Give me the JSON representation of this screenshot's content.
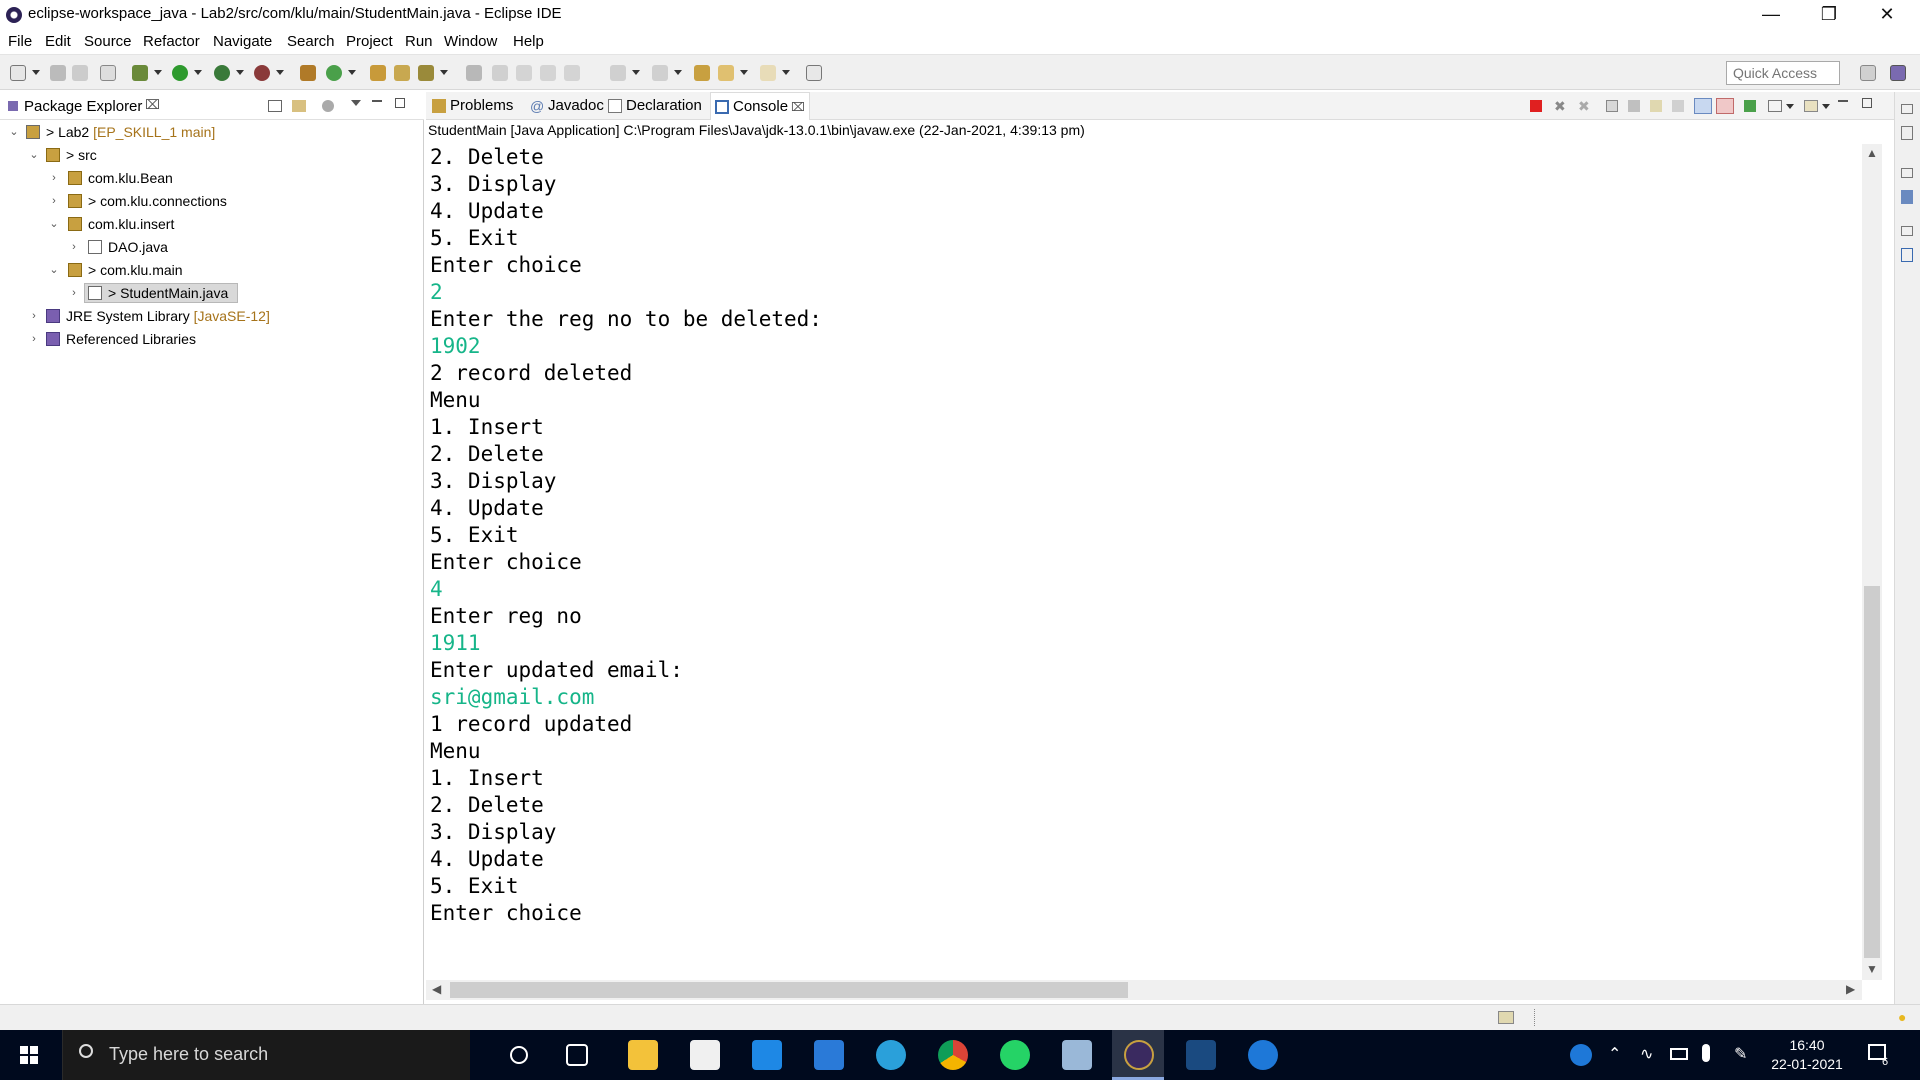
{
  "window": {
    "title": "eclipse-workspace_java - Lab2/src/com/klu/main/StudentMain.java - Eclipse IDE",
    "minimize_icon": "minimize-icon",
    "maximize_icon": "restore-icon",
    "close_icon": "close-icon"
  },
  "menu": [
    "File",
    "Edit",
    "Source",
    "Refactor",
    "Navigate",
    "Search",
    "Project",
    "Run",
    "Window",
    "Help"
  ],
  "toolbar": {
    "quick_access_placeholder": "Quick Access"
  },
  "package_explorer": {
    "title": "Package Explorer",
    "tree": [
      {
        "label": "> Lab2",
        "decoration": " [EP_SKILL_1 main]",
        "icon": "project-icon",
        "expanded": true
      },
      {
        "label": "> src",
        "decoration": "",
        "icon": "source-folder-icon",
        "expanded": true
      },
      {
        "label": "com.klu.Bean",
        "decoration": "",
        "icon": "package-icon",
        "expanded": false
      },
      {
        "label": "> com.klu.connections",
        "decoration": "",
        "icon": "package-icon",
        "expanded": false
      },
      {
        "label": "com.klu.insert",
        "decoration": "",
        "icon": "package-icon",
        "expanded": true
      },
      {
        "label": "DAO.java",
        "decoration": "",
        "icon": "java-file-icon",
        "expanded": false
      },
      {
        "label": "> com.klu.main",
        "decoration": "",
        "icon": "package-icon",
        "expanded": true
      },
      {
        "label": "> StudentMain.java",
        "decoration": "",
        "icon": "java-file-icon",
        "expanded": false,
        "selected": true
      },
      {
        "label": "JRE System Library",
        "decoration": " [JavaSE-12]",
        "icon": "library-icon",
        "expanded": false
      },
      {
        "label": "Referenced Libraries",
        "decoration": "",
        "icon": "library-icon",
        "expanded": false
      }
    ]
  },
  "tabs": [
    {
      "label": "Problems",
      "icon": "problems-icon"
    },
    {
      "label": "Javadoc",
      "icon": "javadoc-icon"
    },
    {
      "label": "Declaration",
      "icon": "declaration-icon"
    },
    {
      "label": "Console",
      "icon": "console-icon",
      "active": true
    }
  ],
  "console": {
    "description": "StudentMain [Java Application] C:\\Program Files\\Java\\jdk-13.0.1\\bin\\javaw.exe (22-Jan-2021, 4:39:13 pm)",
    "lines": [
      {
        "text": "2. Delete",
        "input": false
      },
      {
        "text": "3. Display",
        "input": false
      },
      {
        "text": "4. Update",
        "input": false
      },
      {
        "text": "5. Exit",
        "input": false
      },
      {
        "text": "Enter choice",
        "input": false
      },
      {
        "text": "2",
        "input": true
      },
      {
        "text": "Enter the reg no to be deleted:",
        "input": false
      },
      {
        "text": "1902",
        "input": true
      },
      {
        "text": "2 record deleted",
        "input": false
      },
      {
        "text": "Menu",
        "input": false
      },
      {
        "text": "1. Insert",
        "input": false
      },
      {
        "text": "2. Delete",
        "input": false
      },
      {
        "text": "3. Display",
        "input": false
      },
      {
        "text": "4. Update",
        "input": false
      },
      {
        "text": "5. Exit",
        "input": false
      },
      {
        "text": "Enter choice",
        "input": false
      },
      {
        "text": "4",
        "input": true
      },
      {
        "text": "Enter reg no",
        "input": false
      },
      {
        "text": "1911",
        "input": true
      },
      {
        "text": "Enter updated email:",
        "input": false
      },
      {
        "text": "sri@gmail.com",
        "input": true
      },
      {
        "text": "1 record updated",
        "input": false
      },
      {
        "text": "Menu",
        "input": false
      },
      {
        "text": "1. Insert",
        "input": false
      },
      {
        "text": "2. Delete",
        "input": false
      },
      {
        "text": "3. Display",
        "input": false
      },
      {
        "text": "4. Update",
        "input": false
      },
      {
        "text": "5. Exit",
        "input": false
      },
      {
        "text": "Enter choice",
        "input": false
      }
    ],
    "input_color": "#16b589"
  },
  "taskbar": {
    "search_placeholder": "Type here to search",
    "time": "16:40",
    "date": "22-01-2021",
    "notification_count": "6",
    "apps": [
      "task-view-icon",
      "file-explorer-icon",
      "store-icon",
      "vscode-icon",
      "mail-icon",
      "telegram-icon",
      "chrome-icon",
      "whatsapp-icon",
      "notepad-icon",
      "eclipse-icon",
      "mysql-icon",
      "edge-icon"
    ]
  }
}
